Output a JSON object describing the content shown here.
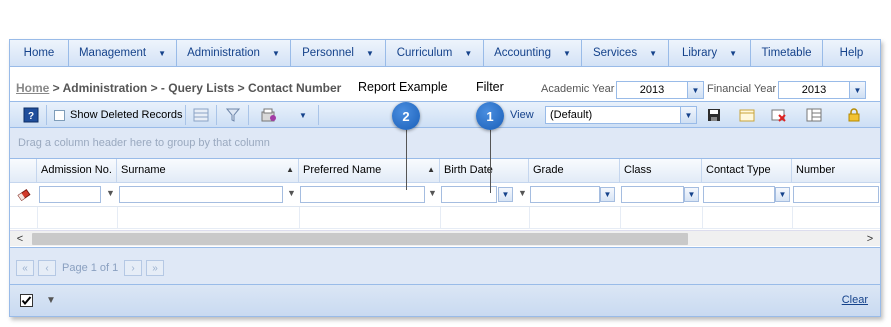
{
  "menu": {
    "items": [
      {
        "label": "Home",
        "has_caret": false
      },
      {
        "label": "Management",
        "has_caret": true
      },
      {
        "label": "Administration",
        "has_caret": true
      },
      {
        "label": "Personnel",
        "has_caret": true
      },
      {
        "label": "Curriculum",
        "has_caret": true
      },
      {
        "label": "Accounting",
        "has_caret": true
      },
      {
        "label": "Services",
        "has_caret": true
      },
      {
        "label": "Library",
        "has_caret": true
      },
      {
        "label": "Timetable",
        "has_caret": false
      },
      {
        "label": "Help",
        "has_caret": false
      }
    ]
  },
  "breadcrumb": {
    "home": "Home",
    "rest": " > Administration > - Query Lists > Contact Number"
  },
  "labels": {
    "report_example": "Report Example",
    "filter": "Filter",
    "academic_year": "Academic Year",
    "financial_year": "Financial Year"
  },
  "selectors": {
    "academic_year_value": "2013",
    "financial_year_value": "2013",
    "view_label": "View",
    "view_value": "(Default)"
  },
  "toolbar": {
    "show_deleted_label": "Show Deleted Records"
  },
  "grid": {
    "group_hint": "Drag a column header here to group by that column",
    "columns": [
      {
        "label": "Admission No.",
        "sort": ""
      },
      {
        "label": "Surname",
        "sort": "▲"
      },
      {
        "label": "Preferred Name",
        "sort": "▲"
      },
      {
        "label": "Birth Date",
        "sort": ""
      },
      {
        "label": "Grade",
        "sort": ""
      },
      {
        "label": "Class",
        "sort": ""
      },
      {
        "label": "Contact Type",
        "sort": ""
      },
      {
        "label": "Number",
        "sort": ""
      }
    ]
  },
  "pager": {
    "text": "Page 1 of 1"
  },
  "footer": {
    "clear_label": "Clear"
  },
  "callouts": {
    "one": "1",
    "two": "2"
  },
  "colors": {
    "accent": "#15428b",
    "border": "#99bbe8",
    "callout": "#1a5fb8"
  }
}
